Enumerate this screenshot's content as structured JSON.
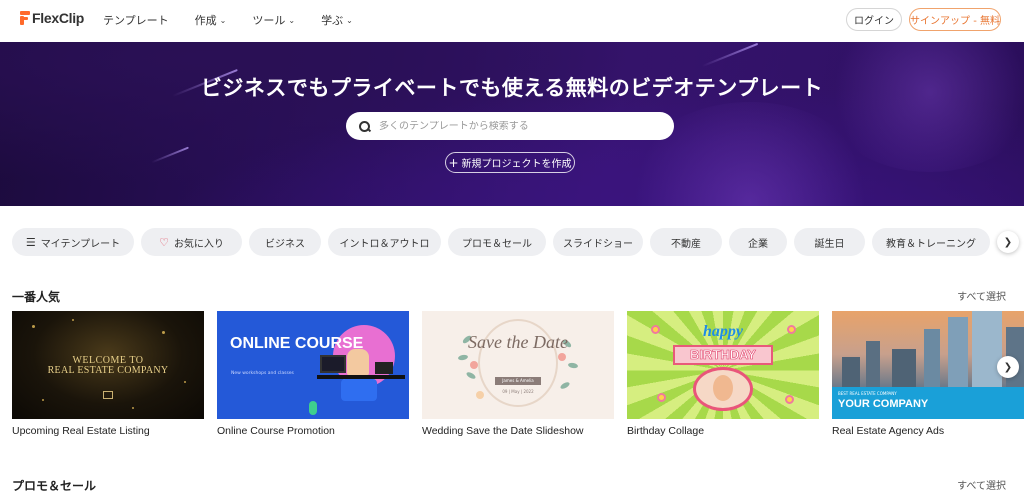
{
  "header": {
    "logo_text": "FlexClip",
    "nav": [
      {
        "label": "テンプレート",
        "dropdown": false
      },
      {
        "label": "作成",
        "dropdown": true
      },
      {
        "label": "ツール",
        "dropdown": true
      },
      {
        "label": "学ぶ",
        "dropdown": true
      }
    ],
    "login_label": "ログイン",
    "signup_label": "サインアップ - 無料"
  },
  "hero": {
    "title": "ビジネスでもプライベートでも使える無料のビデオテンプレート",
    "search_placeholder": "多くのテンプレートから検索する",
    "new_project_label": "新規プロジェクトを作成"
  },
  "categories": [
    {
      "label": "マイテンプレート",
      "icon": "layers-icon"
    },
    {
      "label": "お気に入り",
      "icon": "heart-icon"
    },
    {
      "label": "ビジネス"
    },
    {
      "label": "イントロ＆アウトロ"
    },
    {
      "label": "プロモ＆セール"
    },
    {
      "label": "スライドショー"
    },
    {
      "label": "不動産"
    },
    {
      "label": "企業"
    },
    {
      "label": "誕生日"
    },
    {
      "label": "教育＆トレーニング"
    }
  ],
  "sections": {
    "popular": {
      "title": "一番人気",
      "select_all": "すべて選択",
      "cards": [
        {
          "label": "Upcoming Real Estate Listing",
          "thumb_line1": "WELCOME TO",
          "thumb_line2": "REAL ESTATE COMPANY"
        },
        {
          "label": "Online Course Promotion",
          "thumb_title": "ONLINE COURSE",
          "thumb_sub": "New workshops and classes"
        },
        {
          "label": "Wedding Save the Date Slideshow",
          "thumb_title": "Save the Date",
          "thumb_names": "James & Amelia",
          "thumb_date": "09 | May | 2022"
        },
        {
          "label": "Birthday Collage",
          "thumb_line1": "happy",
          "thumb_line2": "BIRTHDAY"
        },
        {
          "label": "Real Estate Agency Ads",
          "thumb_line1": "BEST REAL ESTATE COMPANY",
          "thumb_line2": "YOUR COMPANY"
        }
      ]
    },
    "promo": {
      "title": "プロモ＆セール",
      "select_all": "すべて選択"
    }
  },
  "colors": {
    "brand": "#ff6a2b",
    "hero_bg": "#2b0f5e",
    "chip_bg": "#eeeff2",
    "signup_border": "#f0a36c"
  }
}
